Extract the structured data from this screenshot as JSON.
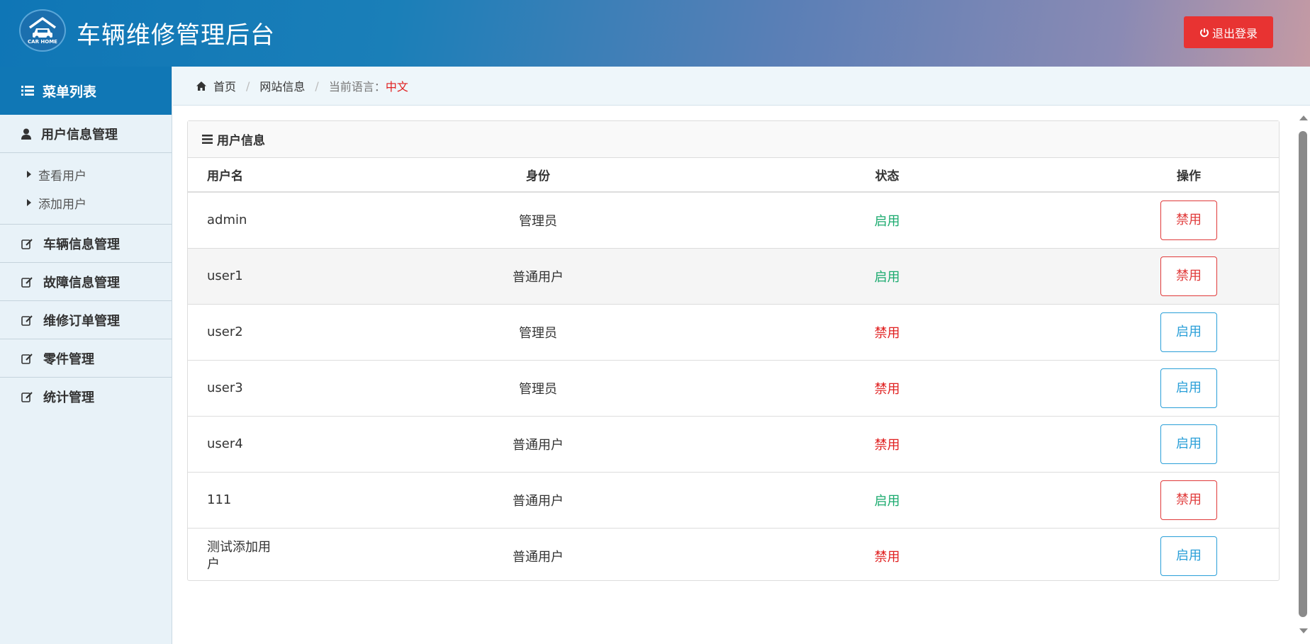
{
  "header": {
    "logo_text": "CAR HOME",
    "title": "车辆维修管理后台",
    "logout_label": "退出登录"
  },
  "sidebar": {
    "title": "菜单列表",
    "groups": [
      {
        "label": "用户信息管理",
        "icon": "user-icon",
        "children": [
          "查看用户",
          "添加用户"
        ]
      },
      {
        "label": "车辆信息管理",
        "icon": "edit-icon"
      },
      {
        "label": "故障信息管理",
        "icon": "edit-icon"
      },
      {
        "label": "维修订单管理",
        "icon": "edit-icon"
      },
      {
        "label": "零件管理",
        "icon": "edit-icon"
      },
      {
        "label": "统计管理",
        "icon": "edit-icon"
      }
    ]
  },
  "breadcrumb": {
    "home": "首页",
    "site": "网站信息",
    "lang_label": "当前语言：",
    "lang_value": "中文"
  },
  "panel": {
    "title": "用户信息",
    "columns": [
      "用户名",
      "身份",
      "状态",
      "操作"
    ],
    "rows": [
      {
        "name": "admin",
        "role": "管理员",
        "status": "启用",
        "action": "禁用"
      },
      {
        "name": "user1",
        "role": "普通用户",
        "status": "启用",
        "action": "禁用"
      },
      {
        "name": "user2",
        "role": "管理员",
        "status": "禁用",
        "action": "启用"
      },
      {
        "name": "user3",
        "role": "管理员",
        "status": "禁用",
        "action": "启用"
      },
      {
        "name": "user4",
        "role": "普通用户",
        "status": "禁用",
        "action": "启用"
      },
      {
        "name": "111",
        "role": "普通用户",
        "status": "启用",
        "action": "禁用"
      },
      {
        "name": "测试添加用户",
        "role": "普通用户",
        "status": "禁用",
        "action": "启用"
      }
    ]
  },
  "colors": {
    "header_blue": "#0f76b6",
    "logout_red": "#e83332",
    "status_on": "#1aaa6e",
    "status_off": "#e02020",
    "btn_blue": "#2a9fd8"
  }
}
